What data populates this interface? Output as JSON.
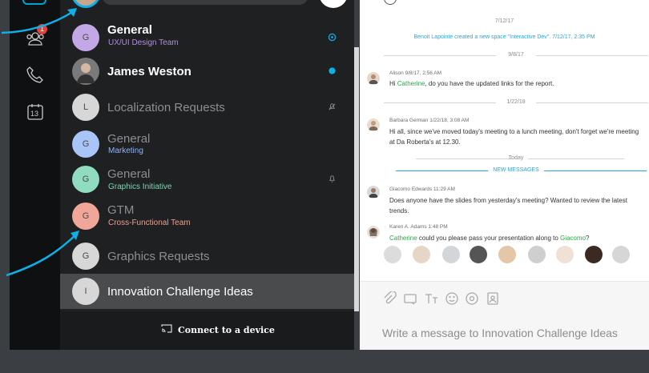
{
  "rail": {
    "badge_count": "1",
    "calendar_day": "13"
  },
  "footer": {
    "label": "Connect to a device"
  },
  "spaces": [
    {
      "avatar_letter": "G",
      "avatar_color": "#c3a8e8",
      "title": "General",
      "subtitle": "UX/UI Design Team",
      "subtitle_color": "#b48be0"
    },
    {
      "avatar_letter": "",
      "avatar_color": "#7a7a7a",
      "title": "James Weston",
      "subtitle": "",
      "subtitle_color": ""
    },
    {
      "avatar_letter": "L",
      "avatar_color": "#d7d7d7",
      "title": "Localization Requests",
      "subtitle": "",
      "subtitle_color": ""
    },
    {
      "avatar_letter": "G",
      "avatar_color": "#a9c4f6",
      "title": "General",
      "subtitle": "Marketing",
      "subtitle_color": "#8fb3f7"
    },
    {
      "avatar_letter": "G",
      "avatar_color": "#8fdcc0",
      "title": "General",
      "subtitle": "Graphics Initiative",
      "subtitle_color": "#7dd3b1"
    },
    {
      "avatar_letter": "G",
      "avatar_color": "#f1a69a",
      "title": "GTM",
      "subtitle": "Cross-Functional Team",
      "subtitle_color": "#ee9f93"
    },
    {
      "avatar_letter": "G",
      "avatar_color": "#d7d7d7",
      "title": "Graphics Requests",
      "subtitle": "",
      "subtitle_color": ""
    },
    {
      "avatar_letter": "I",
      "avatar_color": "#d7d7d7",
      "title": "Innovation Challenge Ideas",
      "subtitle": "",
      "subtitle_color": ""
    }
  ],
  "chat": {
    "system_date_top": "7/12/17",
    "system_event": "Benoit Lapointe created a new space \"Interactive Dev\". 7/12/17, 2:35 PM",
    "date_1": "9/8/17",
    "msg_1_meta": "Alison  9/8/17, 2:56 AM",
    "msg_1_pre": "Hi ",
    "msg_1_mention": "Catherine",
    "msg_1_post": ", do you have the updated links for the report.",
    "date_2": "1/22/18",
    "msg_2_meta": "Barbara German  1/22/18, 3:08 AM",
    "msg_2_body": "Hi all, since we've moved today's meeting to a lunch meeting, don't forget we're meeting at Da Roberta's at 12.30.",
    "date_3": "Today",
    "new_messages": "NEW MESSAGES",
    "msg_3_meta": "Giacomo Edwards  11:29 AM",
    "msg_3_body": "Does anyone have the slides from yesterday's meeting? Wanted to review the latest trends.",
    "msg_4_meta": "Karen A. Adams  1:48 PM",
    "msg_4_mention_a": "Catherine",
    "msg_4_mid": " could you please pass your presentation along to ",
    "msg_4_mention_b": "Giacomo",
    "msg_4_end": "?",
    "composer_placeholder": "Write a message to Innovation Challenge Ideas"
  },
  "colors": {
    "accent": "#0bb1e8",
    "mention": "#31a24c",
    "link": "#2aa5d6"
  },
  "icons": [
    "people-icon",
    "phone-icon",
    "calendar-icon",
    "cast-icon",
    "attach-icon",
    "whiteboard-icon",
    "format-icon",
    "emoji-icon",
    "mention-icon",
    "contact-icon"
  ]
}
